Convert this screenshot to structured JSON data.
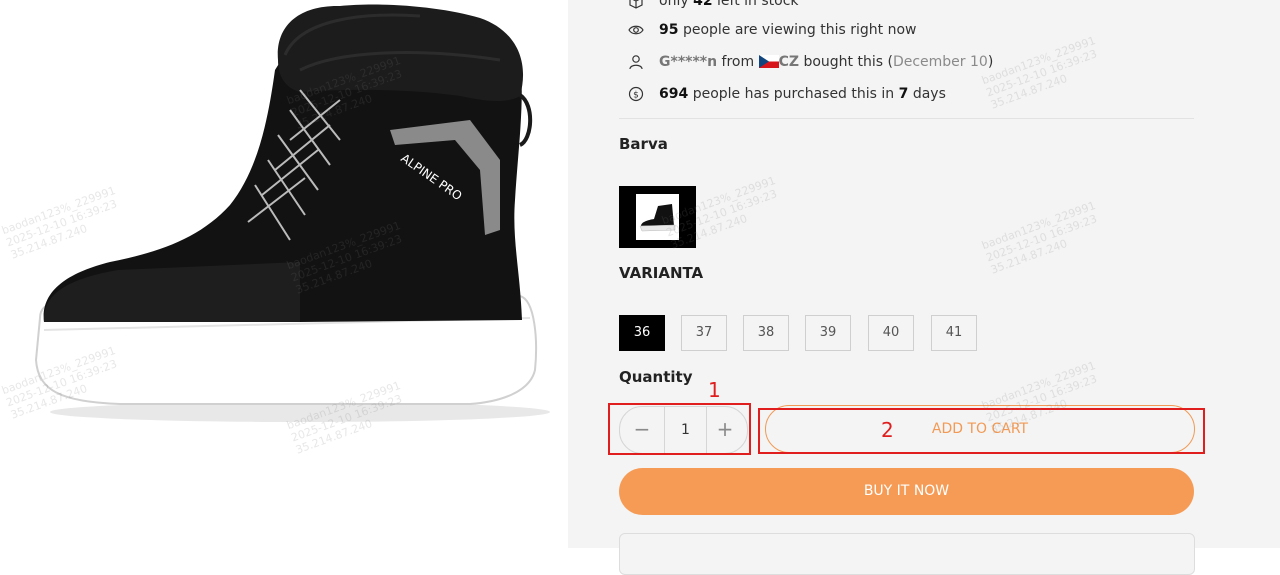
{
  "stats": {
    "stock_text_1": "only",
    "stock_count": "42",
    "stock_text_2": "left in stock",
    "viewing_count": "95",
    "viewing_text": "people are viewing this right now",
    "buyer_name": "G*****n",
    "from_text": "from",
    "country_code": "CZ",
    "bought_text": "bought this (",
    "bought_date": "December 10",
    "bought_close": ")",
    "purchased_count": "694",
    "purchased_text": "people has purchased this in",
    "purchased_days": "7",
    "purchased_days_label": "days"
  },
  "product": {
    "color_label": "Barva",
    "variant_label": "VARIANTA",
    "sizes": [
      "36",
      "37",
      "38",
      "39",
      "40",
      "41"
    ],
    "selected_size": "36",
    "quantity_label": "Quantity",
    "quantity_value": "1",
    "minus_symbol": "−",
    "plus_symbol": "+",
    "add_to_cart": "ADD TO CART",
    "buy_it_now": "BUY IT NOW",
    "brand_on_boot": "ALPINE PRO"
  },
  "annotations": {
    "label_1": "1",
    "label_2": "2"
  },
  "watermark": {
    "line1": "baodan123%_229991",
    "line2": "2025-12-10 16:39:23",
    "line3": "35.214.87.240"
  },
  "colors": {
    "accent": "#f69b55",
    "accent_outline": "#f29a55",
    "annotation": "#e01e1e",
    "selected_size_bg": "#000000"
  },
  "icons": [
    "box-icon",
    "eye-icon",
    "user-icon",
    "dollar-coin-icon",
    "czech-flag-icon"
  ]
}
